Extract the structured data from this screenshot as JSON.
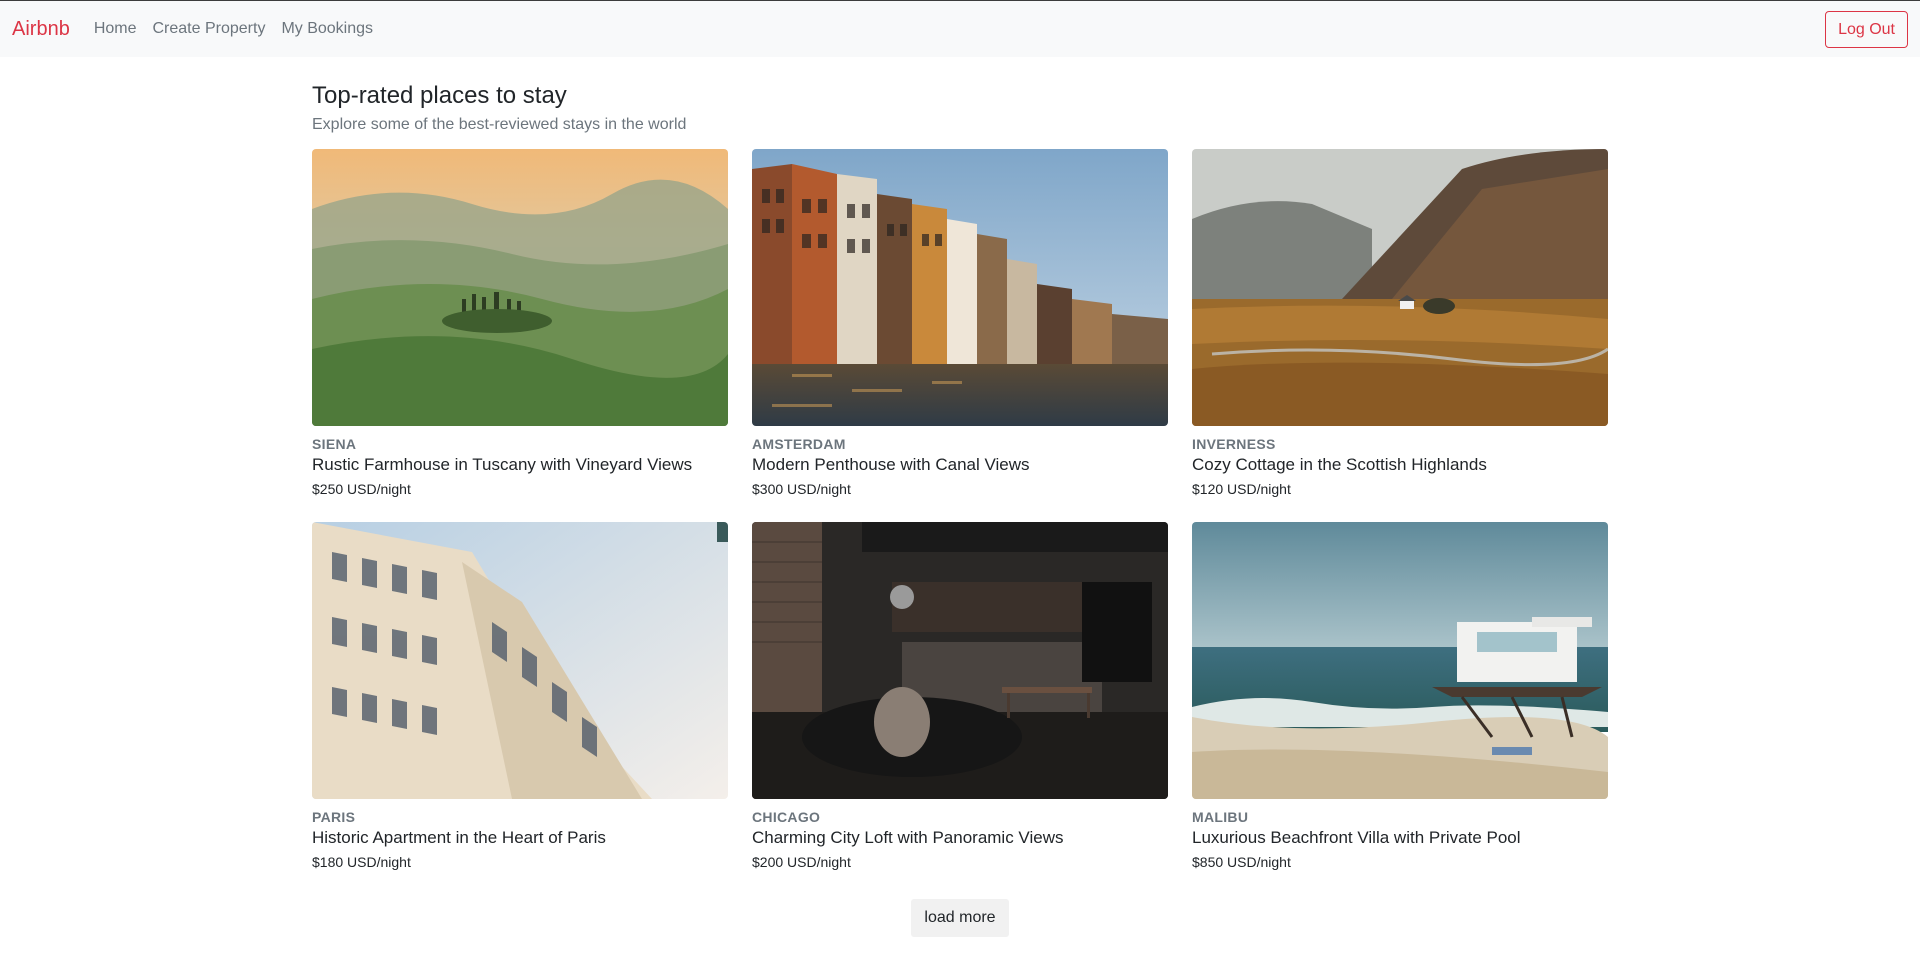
{
  "navbar": {
    "brand": "Airbnb",
    "links": [
      "Home",
      "Create Property",
      "My Bookings"
    ],
    "logout_label": "Log Out"
  },
  "main": {
    "title": "Top-rated places to stay",
    "subtitle": "Explore some of the best-reviewed stays in the world",
    "listings": [
      {
        "city": "SIENA",
        "name": "Rustic Farmhouse in Tuscany with Vineyard Views",
        "price": "$250 USD/night"
      },
      {
        "city": "AMSTERDAM",
        "name": "Modern Penthouse with Canal Views",
        "price": "$300 USD/night"
      },
      {
        "city": "INVERNESS",
        "name": "Cozy Cottage in the Scottish Highlands",
        "price": "$120 USD/night"
      },
      {
        "city": "PARIS",
        "name": "Historic Apartment in the Heart of Paris",
        "price": "$180 USD/night"
      },
      {
        "city": "CHICAGO",
        "name": "Charming City Loft with Panoramic Views",
        "price": "$200 USD/night"
      },
      {
        "city": "MALIBU",
        "name": "Luxurious Beachfront Villa with Private Pool",
        "price": "$850 USD/night"
      }
    ],
    "load_more_label": "load more"
  },
  "colors": {
    "brand": "#dc3545",
    "muted": "#6c757d",
    "navbar_bg": "#f8f9fa"
  }
}
